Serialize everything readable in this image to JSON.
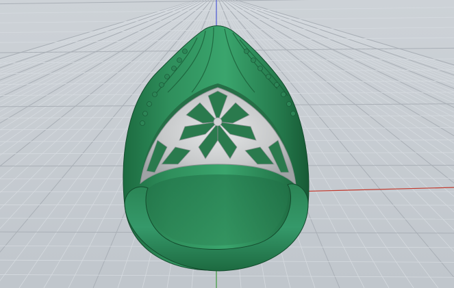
{
  "viewport": {
    "view_type": "perspective",
    "background_color": "#c6ccd2",
    "grid": {
      "visible": true,
      "minor_line_color": "#d6dbe0",
      "major_line_color": "#a9afb6"
    },
    "axes": {
      "x_axis_color": "#c23a2e",
      "y_axis_color": "#3c9a3c",
      "z_axis_color": "#4d5ad6"
    },
    "model": {
      "object": "ring",
      "shank_color": "#2f8a5a",
      "insert_color": "#c9cbcc"
    }
  }
}
